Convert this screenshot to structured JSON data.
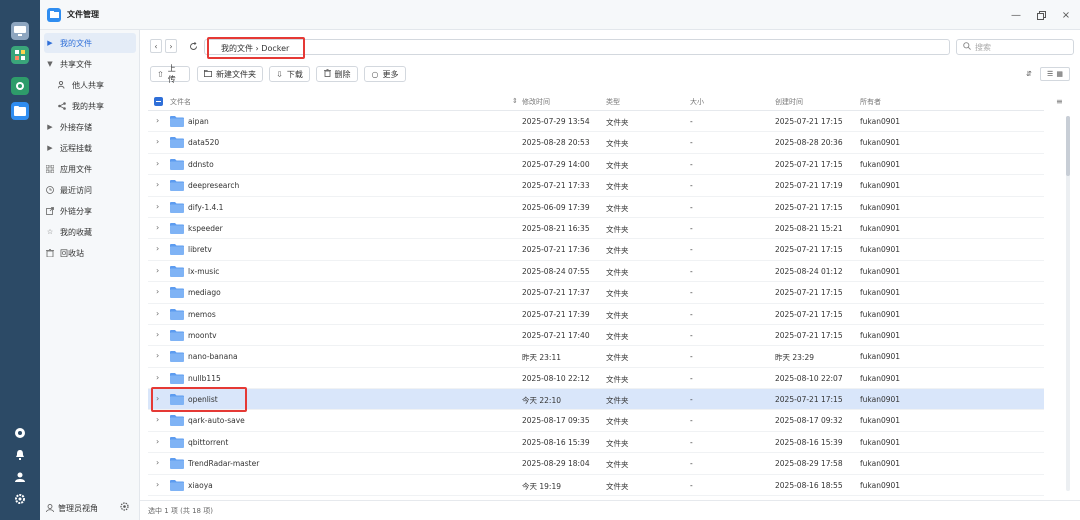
{
  "window": {
    "title": "文件管理"
  },
  "sidebar": {
    "items": [
      {
        "label": "我的文件",
        "icon": "caret-right-icon"
      },
      {
        "label": "共享文件",
        "icon": "caret-down-icon"
      },
      {
        "label": "他人共享",
        "icon": "users-icon"
      },
      {
        "label": "我的共享",
        "icon": "share-icon"
      },
      {
        "label": "外接存储",
        "icon": "caret-right-icon"
      },
      {
        "label": "远程挂载",
        "icon": "caret-right-icon"
      },
      {
        "label": "应用文件",
        "icon": "apps-icon"
      },
      {
        "label": "最近访问",
        "icon": "clock-icon"
      },
      {
        "label": "外链分享",
        "icon": "link-icon"
      },
      {
        "label": "我的收藏",
        "icon": "star-icon"
      },
      {
        "label": "回收站",
        "icon": "trash-icon"
      }
    ],
    "footer": {
      "label": "管理员视角"
    }
  },
  "toolbar": {
    "path": "我的文件 › Docker",
    "search_placeholder": "搜索",
    "buttons": {
      "upload": "上传",
      "new_folder": "新建文件夹",
      "download": "下载",
      "delete": "删除",
      "more": "更多"
    }
  },
  "table": {
    "columns": {
      "name": "文件名",
      "modified": "修改时间",
      "type": "类型",
      "size": "大小",
      "created": "创建时间",
      "owner": "所有者"
    },
    "rows": [
      {
        "name": "aipan",
        "modified": "2025-07-29 13:54",
        "type": "文件夹",
        "size": "-",
        "created": "2025-07-21 17:15",
        "owner": "fukan0901"
      },
      {
        "name": "data520",
        "modified": "2025-08-28 20:53",
        "type": "文件夹",
        "size": "-",
        "created": "2025-08-28 20:36",
        "owner": "fukan0901"
      },
      {
        "name": "ddnsto",
        "modified": "2025-07-29 14:00",
        "type": "文件夹",
        "size": "-",
        "created": "2025-07-21 17:15",
        "owner": "fukan0901"
      },
      {
        "name": "deepresearch",
        "modified": "2025-07-21 17:33",
        "type": "文件夹",
        "size": "-",
        "created": "2025-07-21 17:19",
        "owner": "fukan0901"
      },
      {
        "name": "dify-1.4.1",
        "modified": "2025-06-09 17:39",
        "type": "文件夹",
        "size": "-",
        "created": "2025-07-21 17:15",
        "owner": "fukan0901"
      },
      {
        "name": "kspeeder",
        "modified": "2025-08-21 16:35",
        "type": "文件夹",
        "size": "-",
        "created": "2025-08-21 15:21",
        "owner": "fukan0901"
      },
      {
        "name": "libretv",
        "modified": "2025-07-21 17:36",
        "type": "文件夹",
        "size": "-",
        "created": "2025-07-21 17:15",
        "owner": "fukan0901"
      },
      {
        "name": "lx-music",
        "modified": "2025-08-24 07:55",
        "type": "文件夹",
        "size": "-",
        "created": "2025-08-24 01:12",
        "owner": "fukan0901"
      },
      {
        "name": "mediago",
        "modified": "2025-07-21 17:37",
        "type": "文件夹",
        "size": "-",
        "created": "2025-07-21 17:15",
        "owner": "fukan0901"
      },
      {
        "name": "memos",
        "modified": "2025-07-21 17:39",
        "type": "文件夹",
        "size": "-",
        "created": "2025-07-21 17:15",
        "owner": "fukan0901"
      },
      {
        "name": "moontv",
        "modified": "2025-07-21 17:40",
        "type": "文件夹",
        "size": "-",
        "created": "2025-07-21 17:15",
        "owner": "fukan0901"
      },
      {
        "name": "nano-banana",
        "modified": "昨天 23:11",
        "type": "文件夹",
        "size": "-",
        "created": "昨天 23:29",
        "owner": "fukan0901"
      },
      {
        "name": "nullb115",
        "modified": "2025-08-10 22:12",
        "type": "文件夹",
        "size": "-",
        "created": "2025-08-10 22:07",
        "owner": "fukan0901"
      },
      {
        "name": "openlist",
        "modified": "今天 22:10",
        "type": "文件夹",
        "size": "-",
        "created": "2025-07-21 17:15",
        "owner": "fukan0901",
        "selected": true
      },
      {
        "name": "qark-auto-save",
        "modified": "2025-08-17 09:35",
        "type": "文件夹",
        "size": "-",
        "created": "2025-08-17 09:32",
        "owner": "fukan0901"
      },
      {
        "name": "qbittorrent",
        "modified": "2025-08-16 15:39",
        "type": "文件夹",
        "size": "-",
        "created": "2025-08-16 15:39",
        "owner": "fukan0901"
      },
      {
        "name": "TrendRadar-master",
        "modified": "2025-08-29 18:04",
        "type": "文件夹",
        "size": "-",
        "created": "2025-08-29 17:58",
        "owner": "fukan0901"
      },
      {
        "name": "xiaoya",
        "modified": "今天 19:19",
        "type": "文件夹",
        "size": "-",
        "created": "2025-08-16 18:55",
        "owner": "fukan0901"
      }
    ]
  },
  "status": {
    "text": "选中 1 项 (共 18 项)"
  },
  "colors": {
    "accent": "#2f6fd8",
    "highlight": "#e53935",
    "folder": "#7fb3f5",
    "dock": "#2c4a66"
  }
}
